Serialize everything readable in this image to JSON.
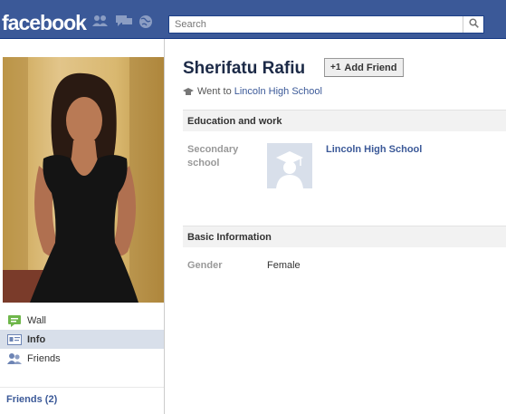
{
  "header": {
    "logo_text": "facebook",
    "search_placeholder": "Search",
    "brand_color": "#3b5998",
    "icons": [
      "friend-requests-icon",
      "messages-icon",
      "notifications-icon",
      "search-icon"
    ]
  },
  "sidebar": {
    "items": [
      {
        "label": "Wall",
        "icon": "wall-icon",
        "selected": false
      },
      {
        "label": "Info",
        "icon": "info-icon",
        "selected": true
      },
      {
        "label": "Friends",
        "icon": "friends-icon",
        "selected": false
      }
    ],
    "friends_link": "Friends (2)"
  },
  "profile": {
    "name": "Sherifatu Rafiu",
    "add_friend_label": "Add Friend",
    "went_to_prefix": "Went to",
    "went_to_school": "Lincoln High School"
  },
  "education": {
    "heading": "Education and work",
    "label": "Secondary school",
    "school": "Lincoln High School"
  },
  "basic_info": {
    "heading": "Basic Information",
    "gender_label": "Gender",
    "gender_value": "Female"
  }
}
